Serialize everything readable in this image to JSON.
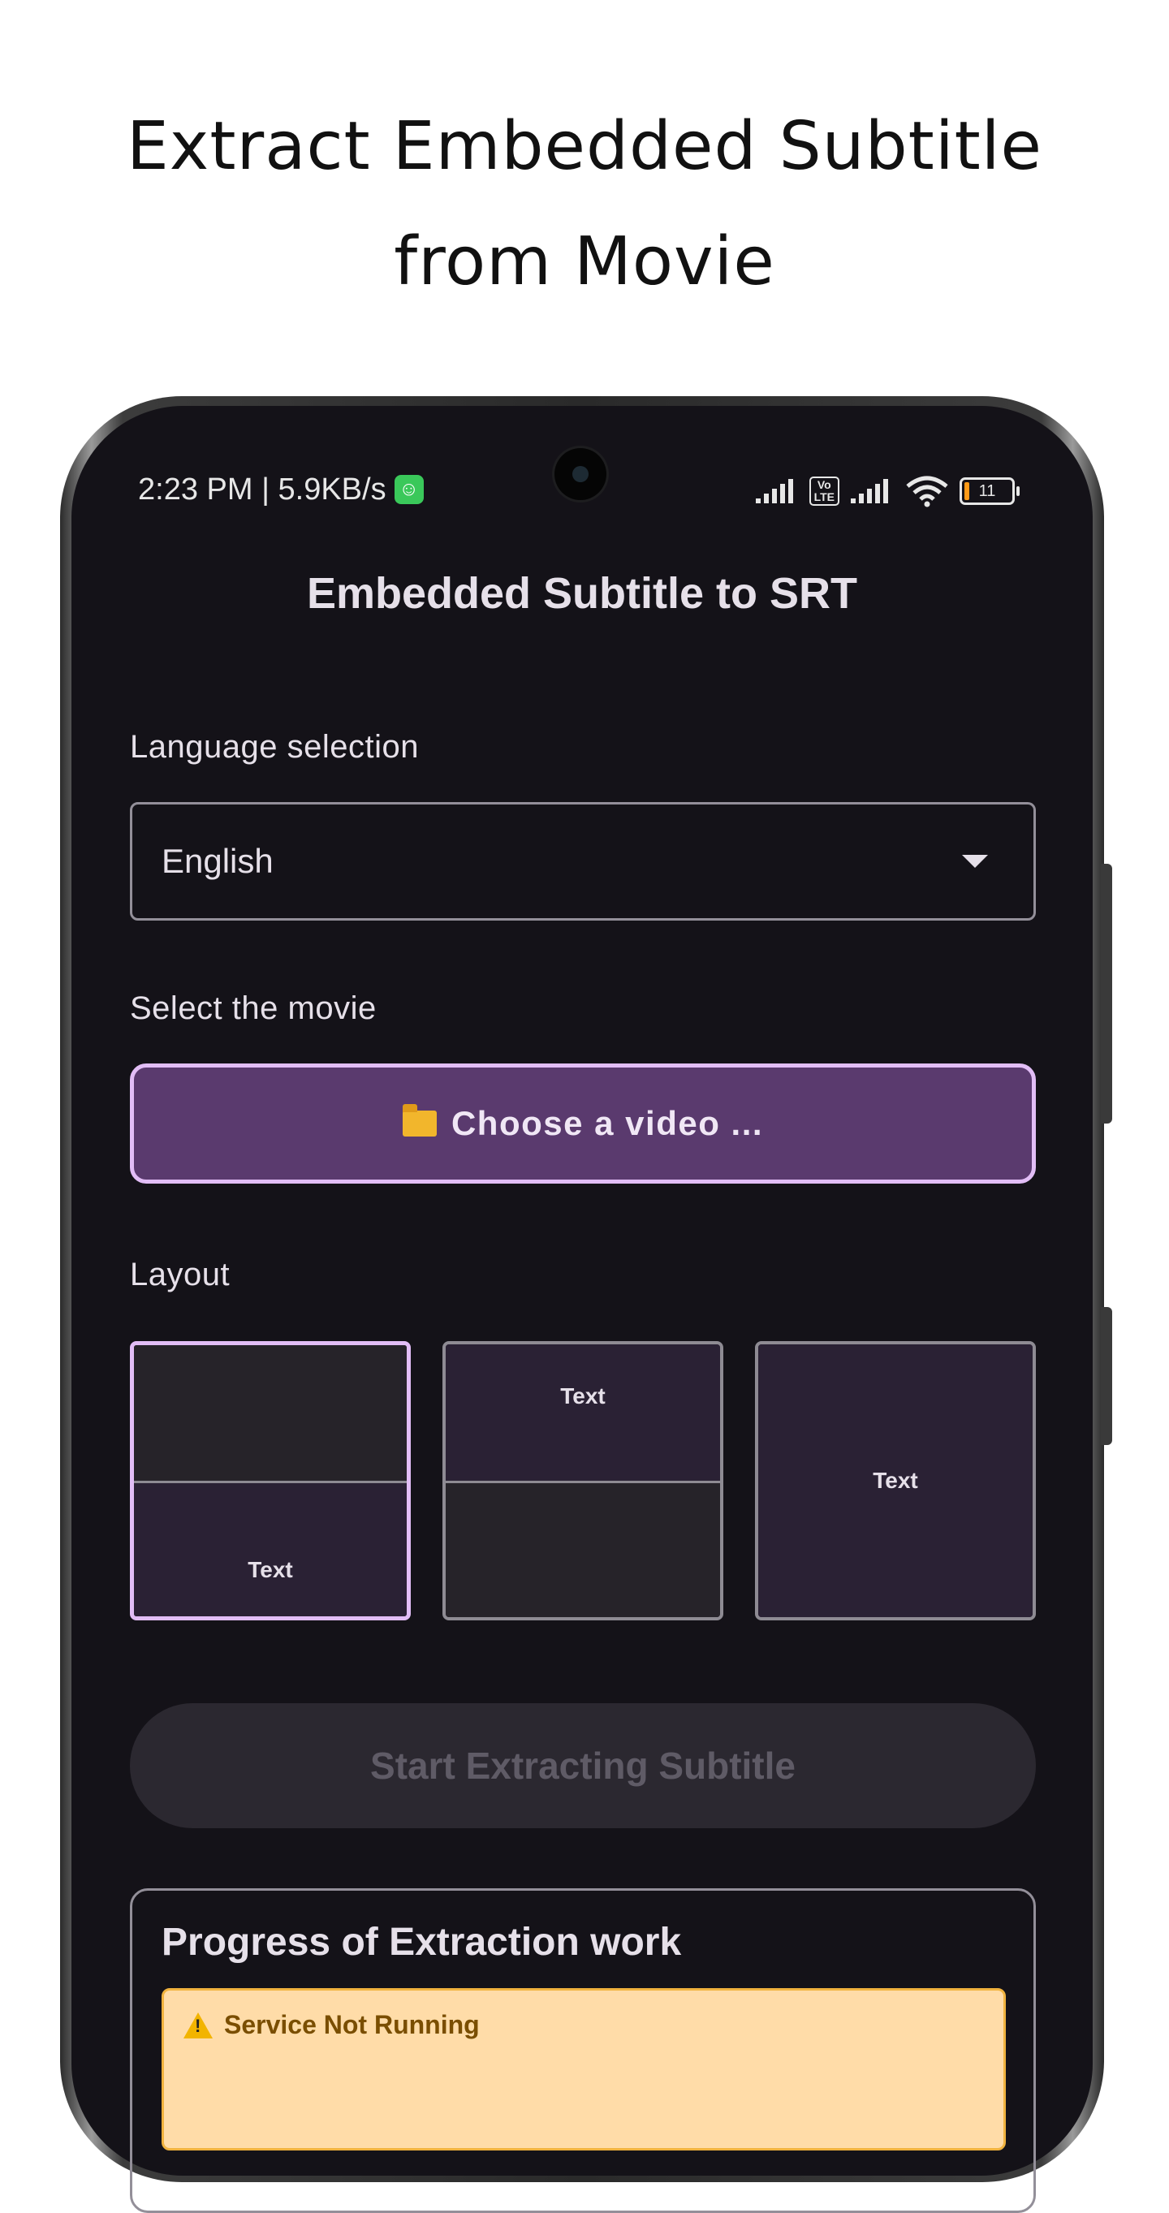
{
  "headline": {
    "line1": "Extract Embedded Subtitle",
    "line2": "from Movie"
  },
  "status_bar": {
    "time_speed": "2:23 PM | 5.9KB/s",
    "volte_line1": "Vo",
    "volte_line2": "LTE",
    "battery": "11",
    "icons": [
      "app-notification-icon",
      "signal-icon",
      "volte-icon",
      "signal-icon",
      "wifi-icon",
      "battery-icon"
    ]
  },
  "app": {
    "title": "Embedded Subtitle to SRT",
    "language_label": "Language selection",
    "language_value": "English",
    "movie_label": "Select the movie",
    "choose_button": "Choose a video ...",
    "layout_label": "Layout",
    "layout_options": [
      {
        "text": "Text",
        "position": "bottom",
        "selected": true
      },
      {
        "text": "Text",
        "position": "top",
        "selected": false
      },
      {
        "text": "Text",
        "position": "full",
        "selected": false
      }
    ],
    "start_button": "Start Extracting Subtitle",
    "progress_title": "Progress of Extraction work",
    "warning": "Service Not Running"
  },
  "colors": {
    "screen_bg": "#141218",
    "accent": "#e2bdf6",
    "button_purple": "#5a3a6e",
    "warning_bg": "#ffdca8"
  }
}
